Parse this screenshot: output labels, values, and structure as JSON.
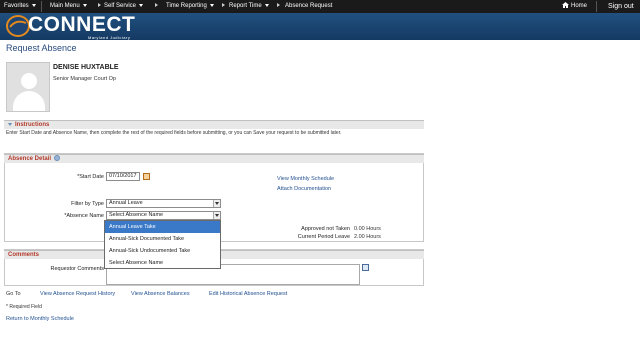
{
  "nav": {
    "favorites": "Favorites",
    "main_menu": "Main Menu",
    "self_service": "Self Service",
    "time_reporting": "Time Reporting",
    "report_time": "Report Time",
    "absence_request": "Absence Request",
    "home": "Home",
    "sign_out": "Sign out"
  },
  "banner": {
    "logo": "CONNECT",
    "sub": "Maryland Judiciary"
  },
  "page_title": "Request Absence",
  "employee": {
    "name": "DENISE HUXTABLE",
    "title": "Senior Manager Court Op"
  },
  "instructions": {
    "header": "Instructions",
    "text": "Enter Start Date and Absence Name, then complete the rest of the required fields before submitting, or you can Save your request to be submitted later."
  },
  "absence_detail": {
    "header": "Absence Detail",
    "start_date_label": "*Start Date",
    "start_date_value": "07/10/2017",
    "filter_label": "Filter by Type",
    "filter_value": "Annual Leave",
    "absence_name_label": "*Absence Name",
    "absence_name_value": "Select Absence Name",
    "view_monthly": "View Monthly Schedule",
    "attach_doc": "Attach Documentation",
    "approved_label": "Approved not Taken",
    "approved_value": "0.00 Hours",
    "current_label": "Current Period Leave",
    "current_value": "2.00 Hours",
    "dropdown_options": [
      "Annual Leave Take",
      "Annual-Sick Documented Take",
      "Annual-Sick Undocumented Take",
      "Select Absence Name"
    ]
  },
  "comments": {
    "header": "Comments",
    "requestor_label": "Requestor Comments"
  },
  "goto": {
    "label": "Go To",
    "history": "View Absence Request History",
    "balances": "View Absence Balances",
    "edit_historical": "Edit Historical Absence Request"
  },
  "required_note": "* Required Field",
  "return_link": "Return to Monthly Schedule",
  "colors": {
    "topbar": "#1a1a1a",
    "banner": "#1d4472",
    "accent": "#e38a1e",
    "link": "#1f4f8f",
    "section_header_text": "#b33a2b",
    "dropdown_selected": "#3a78c8"
  }
}
